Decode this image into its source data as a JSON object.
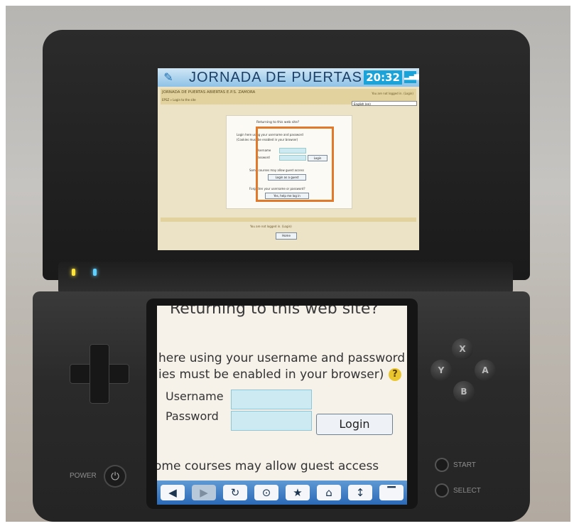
{
  "top_screen": {
    "title": "JORNADA DE PUERTAS AI",
    "clock": "20:32",
    "site_name": "JORNADA DE PUERTAS ABIERTAS E.P.S. ZAMORA",
    "not_logged_in": "You are not logged in. (Login)",
    "skip_link": "EPSZ » Login to the site",
    "language": "English (en)",
    "box_heading": "Returning to this web site?",
    "box_line1": "Login here using your username and password",
    "box_line2": "(Cookies must be enabled in your browser)",
    "username_label": "Username",
    "password_label": "Password",
    "login_label": "Login",
    "guest_text": "Some courses may allow guest access",
    "guest_button": "Login as a guest",
    "forgot_text": "Forgotten your username or password?",
    "forgot_button": "Yes, help me log in",
    "footer_text": "You are not logged in. (Login)",
    "home_button": "Home"
  },
  "bottom_screen": {
    "heading": "Returning to this web site?",
    "line1": "here using your username and password",
    "line2": "ies must be enabled in your browser)",
    "help_icon": "?",
    "username_label": "Username",
    "username_value": "",
    "password_label": "Password",
    "password_value": "",
    "login_button": "Login",
    "guest_text": "ome courses may allow guest access"
  },
  "toolbar": {
    "back": "back-icon",
    "forward": "forward-icon",
    "reload": "reload-icon",
    "search": "binoculars-icon",
    "favorites": "star-icon",
    "home": "home-icon",
    "scroll": "scroll-icon",
    "menu": "menu-icon"
  },
  "console": {
    "power_label": "POWER",
    "start_label": "START",
    "select_label": "SELECT",
    "button_x": "X",
    "button_y": "Y",
    "button_a": "A",
    "button_b": "B"
  },
  "colors": {
    "highlight": "#e07a2a",
    "toolbar": "#2b69b6",
    "input": "#cde9f2"
  }
}
